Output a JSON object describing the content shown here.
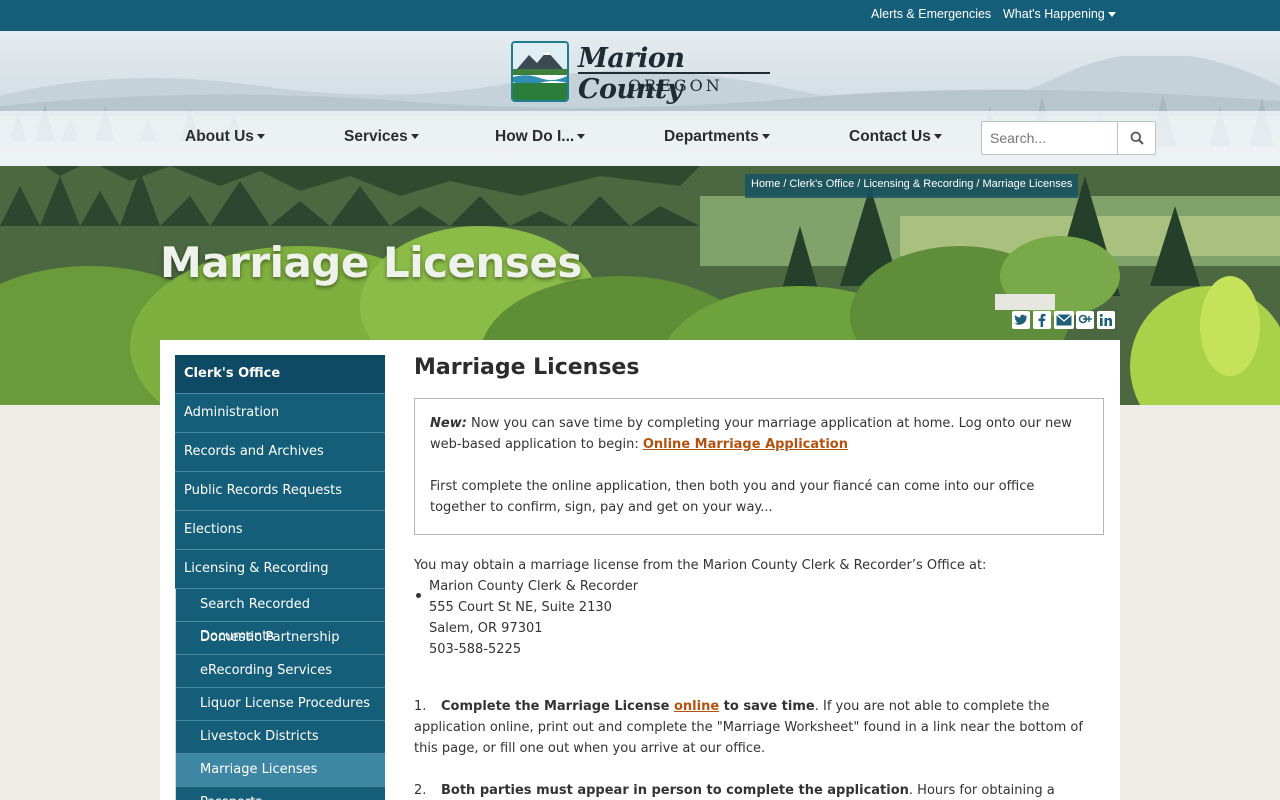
{
  "topbar": {
    "alerts": "Alerts & Emergencies",
    "happening": "What's Happening"
  },
  "logo": {
    "name": "Marion County",
    "sub": "OREGON"
  },
  "nav": {
    "items": [
      "About Us",
      "Services",
      "How Do I...",
      "Departments",
      "Contact Us"
    ],
    "search_placeholder": "Search..."
  },
  "breadcrumb": [
    "Home",
    "Clerk's Office",
    "Licensing & Recording",
    "Marriage Licenses"
  ],
  "hero": {
    "title": "Marriage Licenses"
  },
  "social": [
    "twitter-icon",
    "facebook-icon",
    "email-icon",
    "google-plus-icon",
    "linkedin-icon"
  ],
  "sidebar": {
    "header": "Clerk's Office",
    "items": [
      "Administration",
      "Records and Archives",
      "Public Records Requests",
      "Elections",
      "Licensing & Recording"
    ],
    "subitems": [
      "Search Recorded Documents",
      "Domestic Partnership",
      "eRecording Services",
      "Liquor License Procedures",
      "Livestock Districts",
      "Marriage Licenses",
      "Passports"
    ]
  },
  "main": {
    "title": "Marriage Licenses",
    "notice": {
      "new_label": "New:",
      "text1": " Now you can save time by completing your marriage application at home.  Log onto our new web-based application to begin: ",
      "link": "Online Marriage Application",
      "text2": "First complete the online application, then both you and your fiancé can come into our office together to confirm, sign, pay and get on your way..."
    },
    "intro": "You may obtain a marriage license from the Marion County Clerk & Recorder’s Office at:",
    "address": [
      "Marion County Clerk & Recorder",
      "555 Court St NE, Suite 2130",
      "Salem, OR  97301",
      "503-588-5225"
    ],
    "step1": {
      "num": "1.",
      "bold1": "Complete the Marriage License ",
      "link": "online",
      "bold2": " to save time",
      "text": ".  If you are not able to complete the application online, print out and complete the \"Marriage Worksheet\" found in a link near the bottom of this page, or fill one out when you arrive at our office."
    },
    "step2": {
      "num": "2.",
      "bold": "Both parties must appear in person to complete the application",
      "text": ".  Hours for obtaining a marriage license are"
    }
  },
  "colors": {
    "primary": "#155e7a",
    "link": "#b4520f"
  }
}
